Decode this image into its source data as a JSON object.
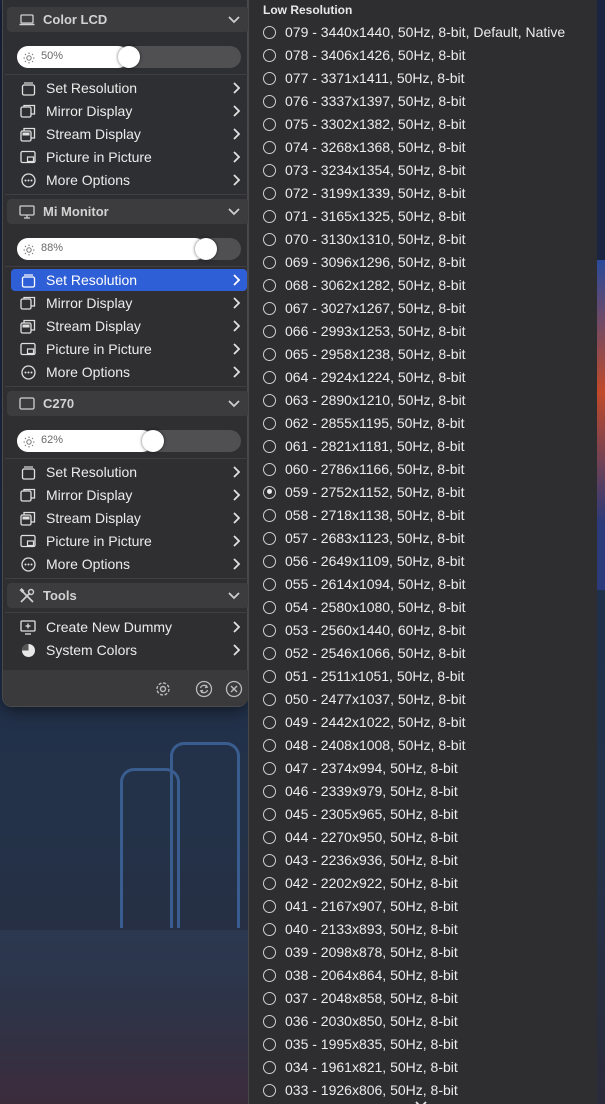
{
  "colors": {
    "selected": "#2f5fd6",
    "panel": "#303032",
    "header": "#3c3c3e"
  },
  "displays": [
    {
      "name": "Color LCD",
      "icon": "laptop-icon",
      "brightness_pct": 50,
      "brightness_label": "50%",
      "items": [
        {
          "label": "Set Resolution",
          "icon": "display-stack-icon",
          "selected": false
        },
        {
          "label": "Mirror Display",
          "icon": "mirror-display-icon",
          "selected": false
        },
        {
          "label": "Stream Display",
          "icon": "stream-display-icon",
          "selected": false
        },
        {
          "label": "Picture in Picture",
          "icon": "picture-in-picture-icon",
          "selected": false
        },
        {
          "label": "More Options",
          "icon": "ellipsis-circle-icon",
          "selected": false
        }
      ]
    },
    {
      "name": "Mi Monitor",
      "icon": "monitor-icon",
      "brightness_pct": 88,
      "brightness_label": "88%",
      "items": [
        {
          "label": "Set Resolution",
          "icon": "display-stack-icon",
          "selected": true
        },
        {
          "label": "Mirror Display",
          "icon": "mirror-display-icon",
          "selected": false
        },
        {
          "label": "Stream Display",
          "icon": "stream-display-icon",
          "selected": false
        },
        {
          "label": "Picture in Picture",
          "icon": "picture-in-picture-icon",
          "selected": false
        },
        {
          "label": "More Options",
          "icon": "ellipsis-circle-icon",
          "selected": false
        }
      ]
    },
    {
      "name": "C270",
      "icon": "display-icon",
      "brightness_pct": 62,
      "brightness_label": "62%",
      "items": [
        {
          "label": "Set Resolution",
          "icon": "display-stack-icon",
          "selected": false
        },
        {
          "label": "Mirror Display",
          "icon": "mirror-display-icon",
          "selected": false
        },
        {
          "label": "Stream Display",
          "icon": "stream-display-icon",
          "selected": false
        },
        {
          "label": "Picture in Picture",
          "icon": "picture-in-picture-icon",
          "selected": false
        },
        {
          "label": "More Options",
          "icon": "ellipsis-circle-icon",
          "selected": false
        }
      ]
    }
  ],
  "tools": {
    "name": "Tools",
    "icon": "tools-icon",
    "items": [
      {
        "label": "Create New Dummy",
        "icon": "add-display-icon"
      },
      {
        "label": "System Colors",
        "icon": "color-wheel-icon"
      }
    ]
  },
  "footer": {
    "icons": [
      "gear-icon",
      "refresh-icon",
      "close-circle-icon"
    ]
  },
  "resolution_list": {
    "title": "Low Resolution",
    "items": [
      {
        "label": "079 - 3440x1440, 50Hz, 8-bit, Default, Native",
        "selected": false
      },
      {
        "label": "078 - 3406x1426, 50Hz, 8-bit",
        "selected": false
      },
      {
        "label": "077 - 3371x1411, 50Hz, 8-bit",
        "selected": false
      },
      {
        "label": "076 - 3337x1397, 50Hz, 8-bit",
        "selected": false
      },
      {
        "label": "075 - 3302x1382, 50Hz, 8-bit",
        "selected": false
      },
      {
        "label": "074 - 3268x1368, 50Hz, 8-bit",
        "selected": false
      },
      {
        "label": "073 - 3234x1354, 50Hz, 8-bit",
        "selected": false
      },
      {
        "label": "072 - 3199x1339, 50Hz, 8-bit",
        "selected": false
      },
      {
        "label": "071 - 3165x1325, 50Hz, 8-bit",
        "selected": false
      },
      {
        "label": "070 - 3130x1310, 50Hz, 8-bit",
        "selected": false
      },
      {
        "label": "069 - 3096x1296, 50Hz, 8-bit",
        "selected": false
      },
      {
        "label": "068 - 3062x1282, 50Hz, 8-bit",
        "selected": false
      },
      {
        "label": "067 - 3027x1267, 50Hz, 8-bit",
        "selected": false
      },
      {
        "label": "066 - 2993x1253, 50Hz, 8-bit",
        "selected": false
      },
      {
        "label": "065 - 2958x1238, 50Hz, 8-bit",
        "selected": false
      },
      {
        "label": "064 - 2924x1224, 50Hz, 8-bit",
        "selected": false
      },
      {
        "label": "063 - 2890x1210, 50Hz, 8-bit",
        "selected": false
      },
      {
        "label": "062 - 2855x1195, 50Hz, 8-bit",
        "selected": false
      },
      {
        "label": "061 - 2821x1181, 50Hz, 8-bit",
        "selected": false
      },
      {
        "label": "060 - 2786x1166, 50Hz, 8-bit",
        "selected": false
      },
      {
        "label": "059 - 2752x1152, 50Hz, 8-bit",
        "selected": true
      },
      {
        "label": "058 - 2718x1138, 50Hz, 8-bit",
        "selected": false
      },
      {
        "label": "057 - 2683x1123, 50Hz, 8-bit",
        "selected": false
      },
      {
        "label": "056 - 2649x1109, 50Hz, 8-bit",
        "selected": false
      },
      {
        "label": "055 - 2614x1094, 50Hz, 8-bit",
        "selected": false
      },
      {
        "label": "054 - 2580x1080, 50Hz, 8-bit",
        "selected": false
      },
      {
        "label": "053 - 2560x1440, 60Hz, 8-bit",
        "selected": false
      },
      {
        "label": "052 - 2546x1066, 50Hz, 8-bit",
        "selected": false
      },
      {
        "label": "051 - 2511x1051, 50Hz, 8-bit",
        "selected": false
      },
      {
        "label": "050 - 2477x1037, 50Hz, 8-bit",
        "selected": false
      },
      {
        "label": "049 - 2442x1022, 50Hz, 8-bit",
        "selected": false
      },
      {
        "label": "048 - 2408x1008, 50Hz, 8-bit",
        "selected": false
      },
      {
        "label": "047 - 2374x994, 50Hz, 8-bit",
        "selected": false
      },
      {
        "label": "046 - 2339x979, 50Hz, 8-bit",
        "selected": false
      },
      {
        "label": "045 - 2305x965, 50Hz, 8-bit",
        "selected": false
      },
      {
        "label": "044 - 2270x950, 50Hz, 8-bit",
        "selected": false
      },
      {
        "label": "043 - 2236x936, 50Hz, 8-bit",
        "selected": false
      },
      {
        "label": "042 - 2202x922, 50Hz, 8-bit",
        "selected": false
      },
      {
        "label": "041 - 2167x907, 50Hz, 8-bit",
        "selected": false
      },
      {
        "label": "040 - 2133x893, 50Hz, 8-bit",
        "selected": false
      },
      {
        "label": "039 - 2098x878, 50Hz, 8-bit",
        "selected": false
      },
      {
        "label": "038 - 2064x864, 50Hz, 8-bit",
        "selected": false
      },
      {
        "label": "037 - 2048x858, 50Hz, 8-bit",
        "selected": false
      },
      {
        "label": "036 - 2030x850, 50Hz, 8-bit",
        "selected": false
      },
      {
        "label": "035 - 1995x835, 50Hz, 8-bit",
        "selected": false
      },
      {
        "label": "034 - 1961x821, 50Hz, 8-bit",
        "selected": false
      },
      {
        "label": "033 - 1926x806, 50Hz, 8-bit",
        "selected": false
      }
    ]
  }
}
